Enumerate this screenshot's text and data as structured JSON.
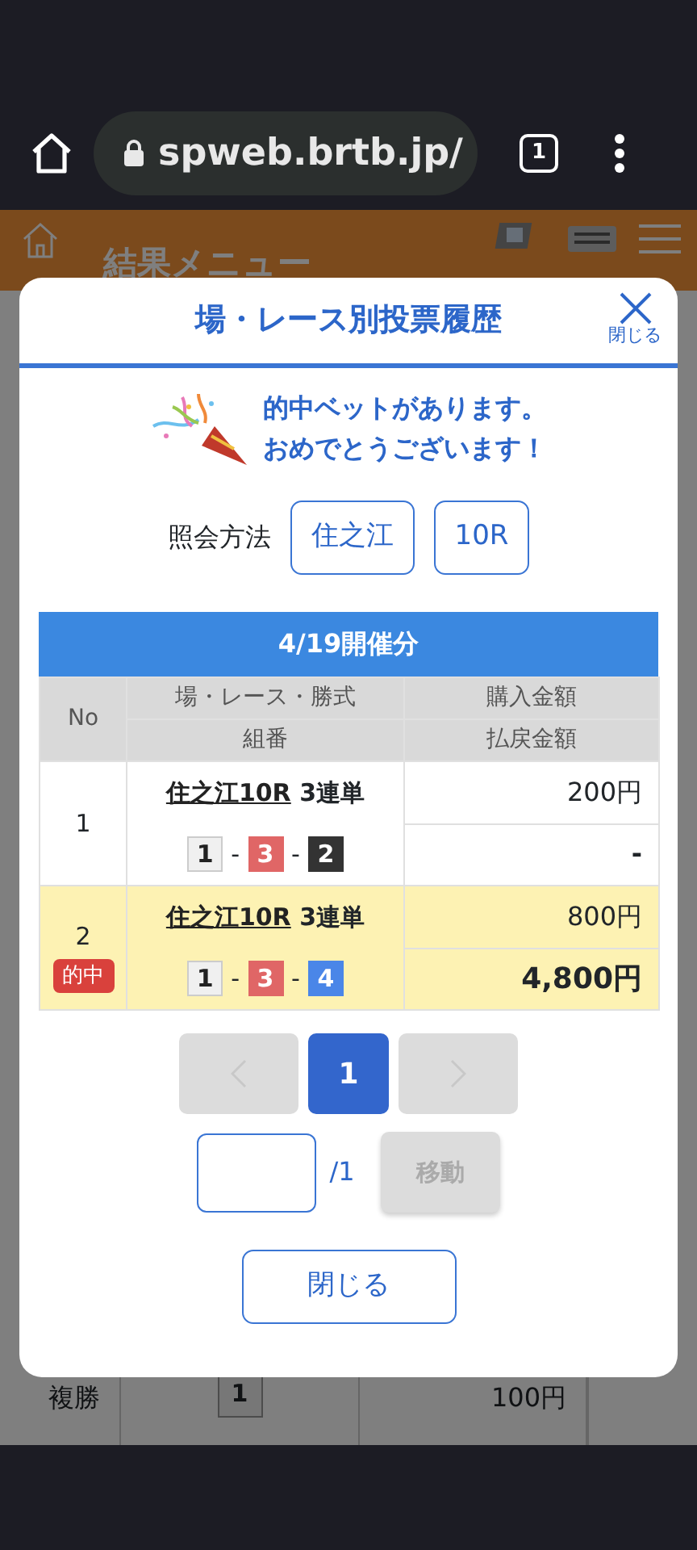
{
  "browser": {
    "url": "spweb.brtb.jp/",
    "tab_count": "1"
  },
  "background_page": {
    "header": {
      "title": "結果メニュー",
      "nav_items": [
        {
          "kind": "home"
        },
        {
          "kind": "deposit"
        },
        {
          "kind": "betlist"
        },
        {
          "kind": "menu"
        }
      ]
    },
    "rows": [
      {
        "bet_type": "複勝",
        "combo": "1",
        "amount": "100円"
      }
    ]
  },
  "modal": {
    "title": "場・レース別投票履歴",
    "close_label": "閉じる",
    "message": [
      "的中ベットがあります。",
      "おめでとうございます！"
    ],
    "query": {
      "label": "照会方法",
      "buttons": [
        "住之江",
        "10R"
      ]
    },
    "table": {
      "date_title": "4/19開催分",
      "columns": {
        "no": "No",
        "race": "場・レース・勝式",
        "combo": "組番",
        "purchase": "購入金額",
        "payout": "払戻金額"
      },
      "rows": [
        {
          "no": "1",
          "hit": false,
          "race_link": "住之江10R",
          "bet_type": "3連単",
          "combo_separators": [
            "-",
            "-"
          ],
          "combo": [
            {
              "number": "1",
              "color": "#f0f0f0"
            },
            {
              "number": "3",
              "color": "#e06666"
            },
            {
              "number": "2",
              "color": "#333333"
            }
          ],
          "purchase": "200円",
          "payout": "-"
        },
        {
          "no": "2",
          "hit": true,
          "hit_label": "的中",
          "race_link": "住之江10R",
          "bet_type": "3連単",
          "combo_separators": [
            "-",
            "-"
          ],
          "combo": [
            {
              "number": "1",
              "color": "#f0f0f0"
            },
            {
              "number": "3",
              "color": "#e06666"
            },
            {
              "number": "4",
              "color": "#4a86e8"
            }
          ],
          "purchase": "800円",
          "payout": "4,800円"
        }
      ]
    },
    "pagination": {
      "prev_disabled": true,
      "next_disabled": true,
      "pages": [
        {
          "label": "1",
          "selected": true
        }
      ]
    },
    "jump": {
      "total": "/1",
      "button": "移動",
      "button_disabled": true
    },
    "close_button": "閉じる"
  }
}
